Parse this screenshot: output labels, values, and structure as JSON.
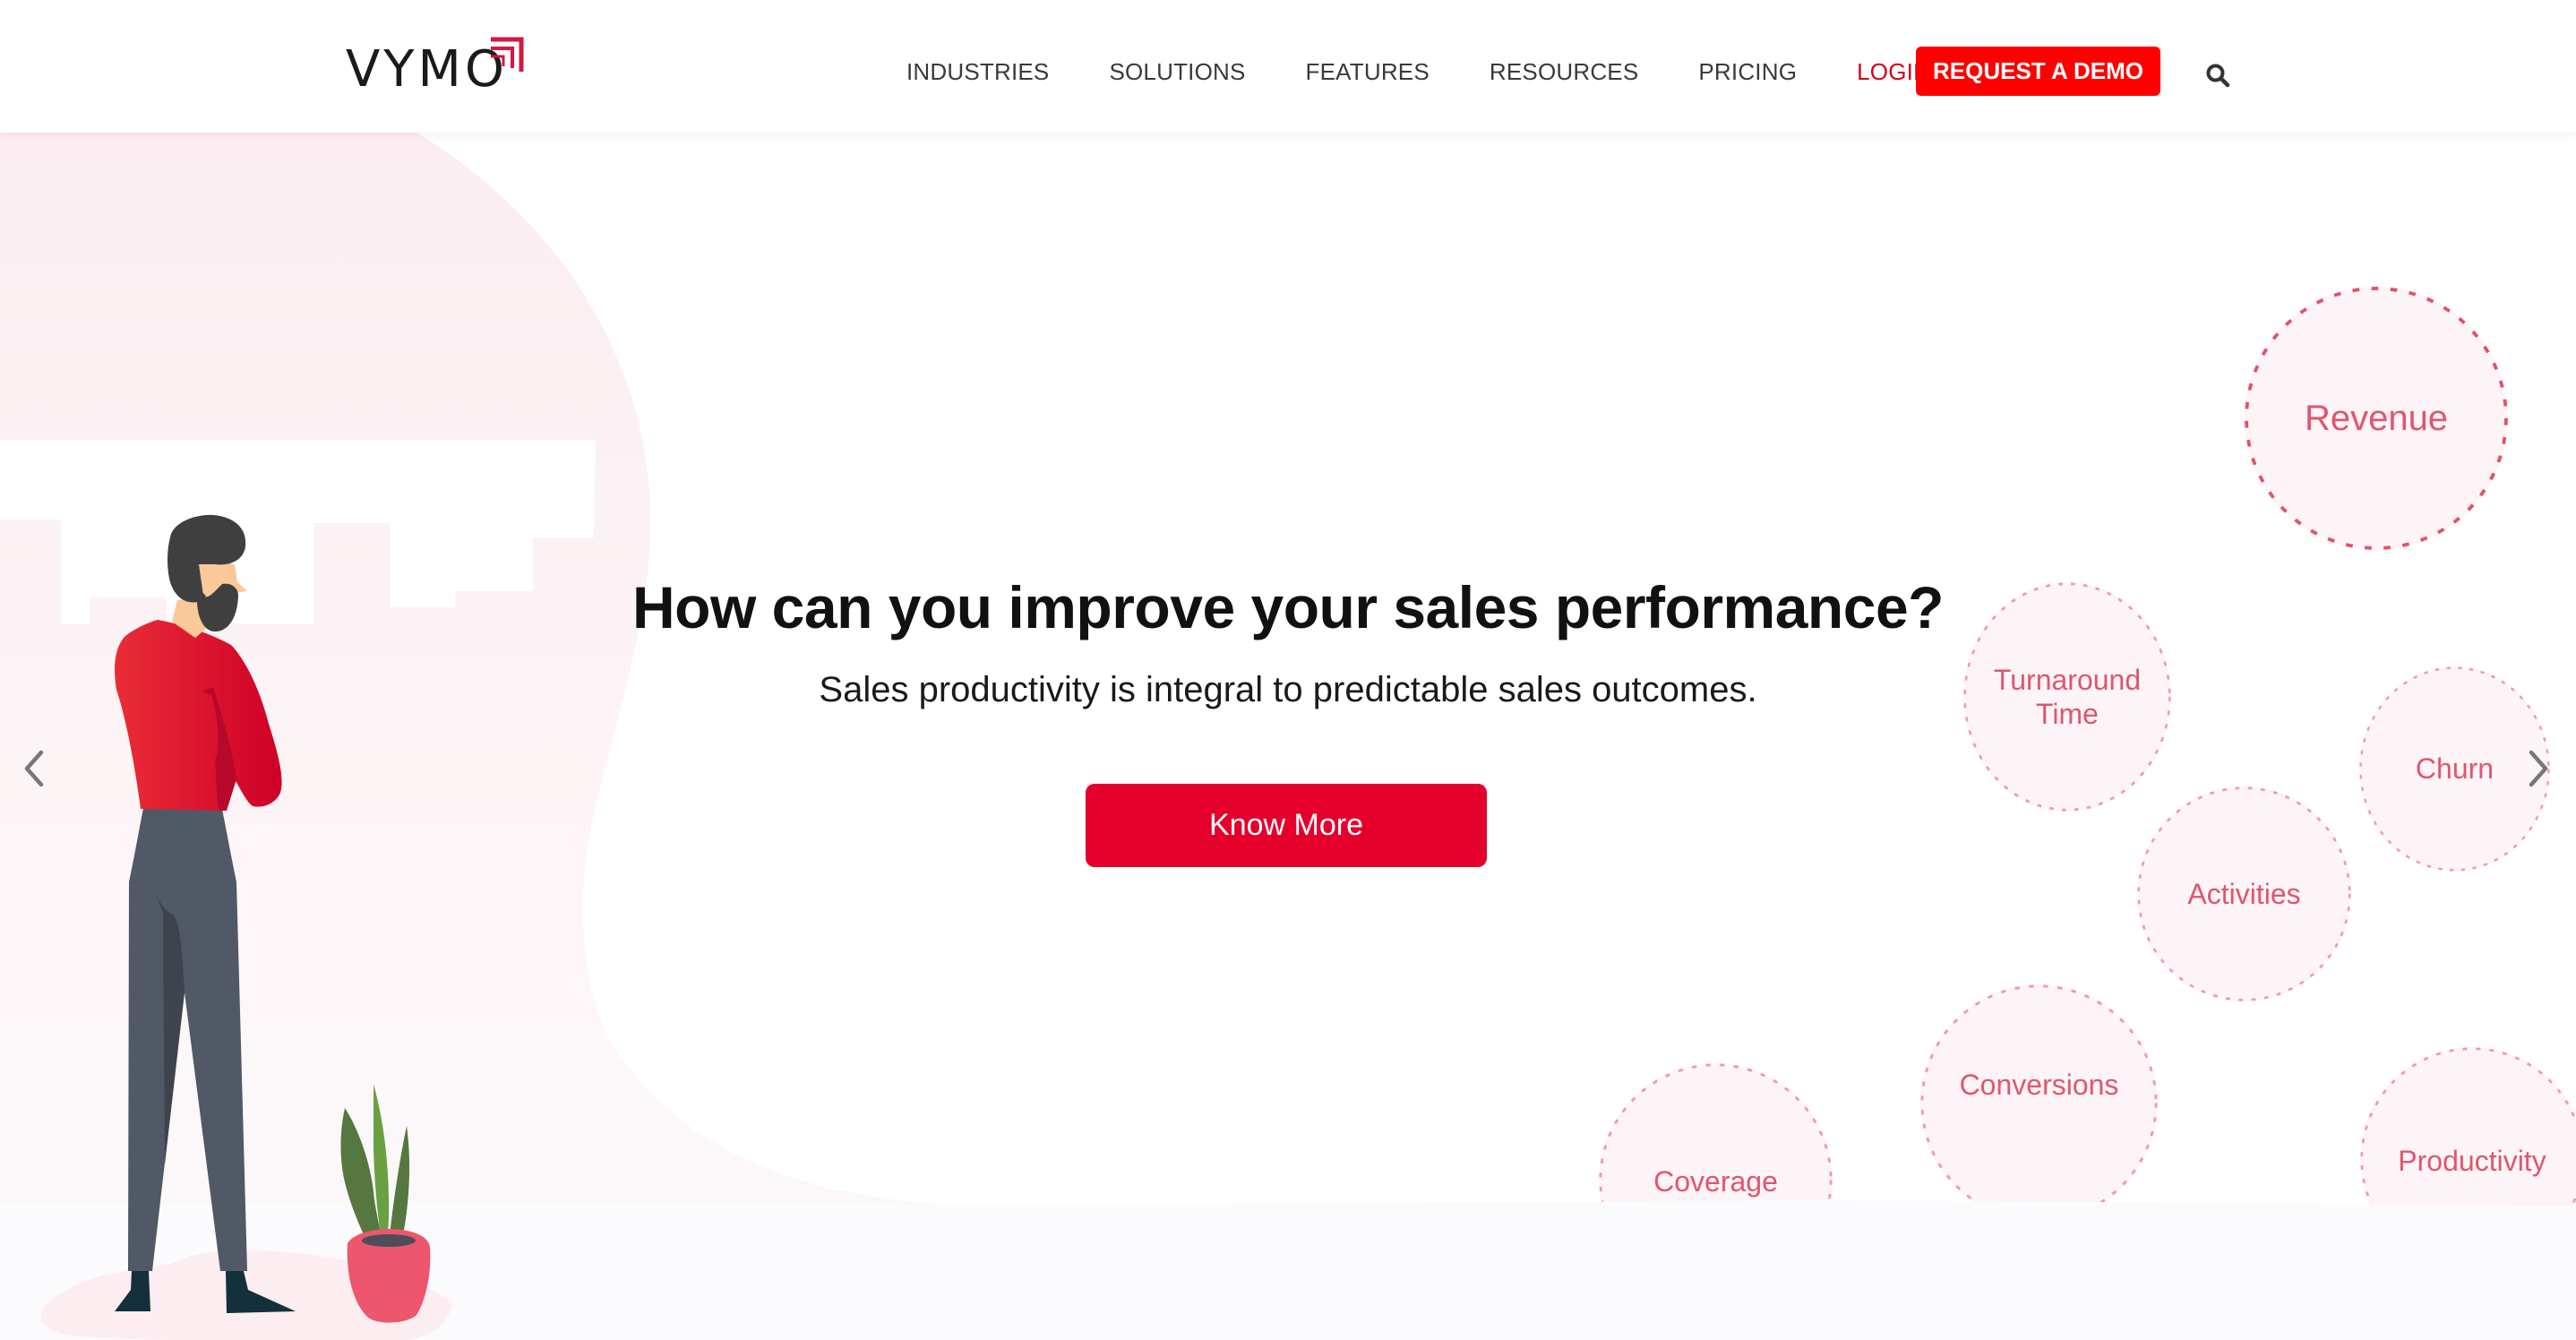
{
  "header": {
    "logo_text": "VYMO",
    "nav": [
      {
        "label": "INDUSTRIES"
      },
      {
        "label": "SOLUTIONS"
      },
      {
        "label": "FEATURES"
      },
      {
        "label": "RESOURCES"
      },
      {
        "label": "PRICING"
      },
      {
        "label": "LOGIN"
      }
    ],
    "cta_label": "REQUEST A DEMO",
    "search_icon": "search-icon"
  },
  "hero": {
    "title": "How can you improve your sales performance?",
    "subtitle": "Sales productivity is integral to predictable sales outcomes.",
    "button_label": "Know More",
    "bubbles": [
      {
        "label": "Revenue"
      },
      {
        "label": "Turnaround Time"
      },
      {
        "label": "Churn"
      },
      {
        "label": "Activities"
      },
      {
        "label": "Conversions"
      },
      {
        "label": "Coverage"
      },
      {
        "label": "Productivity"
      }
    ],
    "prev_icon": "chevron-left-icon",
    "next_icon": "chevron-right-icon"
  },
  "colors": {
    "brand_red": "#e4002b",
    "cta_red": "#ff0000",
    "login_red": "#d0021b",
    "bubble_text": "#e0566e",
    "nav_text": "#3a3a3a"
  }
}
